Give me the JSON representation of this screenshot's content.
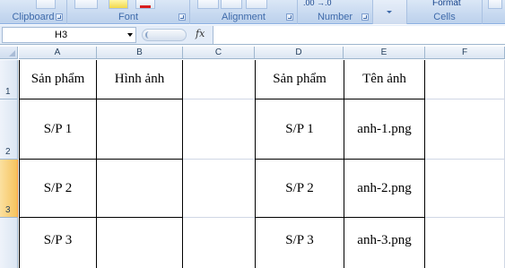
{
  "ribbon": {
    "groups": [
      {
        "label": "Clipboard"
      },
      {
        "label": "Font"
      },
      {
        "label": "Alignment"
      },
      {
        "label": "Number"
      },
      {
        "label": "Cells"
      }
    ],
    "number_format_text": ".00 →.0",
    "format_label": "Format"
  },
  "formula_bar": {
    "name_box": "H3",
    "fx": "fx",
    "formula": ""
  },
  "columns": [
    "A",
    "B",
    "C",
    "D",
    "E",
    "F"
  ],
  "rows": [
    "1",
    "2",
    "3"
  ],
  "active_row": "3",
  "cells": {
    "A1": "Sản phẩm",
    "B1": "Hình ảnh",
    "D1": "Sản phẩm",
    "E1": "Tên ảnh",
    "A2": "S/P 1",
    "D2": "S/P 1",
    "E2": "anh-1.png",
    "A3": "S/P 2",
    "D3": "S/P 2",
    "E3": "anh-2.png",
    "A4": "S/P 3",
    "D4": "S/P 3",
    "E4": "anh-3.png"
  }
}
